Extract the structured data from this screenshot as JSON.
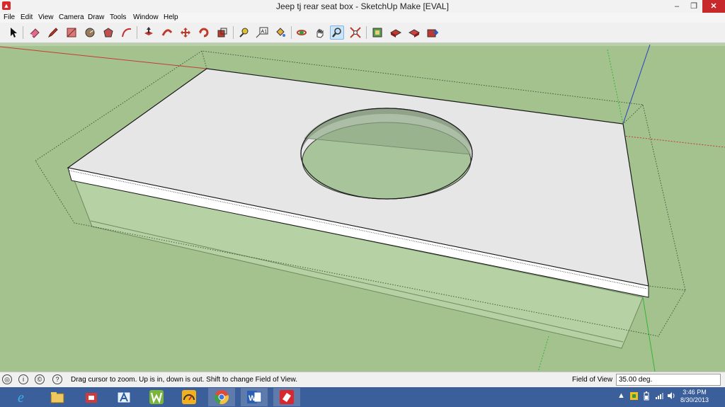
{
  "window": {
    "title": "Jeep tj rear seat box - SketchUp Make [EVAL]",
    "minimize": "–",
    "maximize": "❐",
    "close": "✕"
  },
  "menu": [
    "File",
    "Edit",
    "View",
    "Camera",
    "Draw",
    "Tools",
    "Window",
    "Help"
  ],
  "toolbar": {
    "tools": [
      "select-tool",
      "eraser-tool",
      "pencil-tool",
      "rectangle-tool",
      "circle-tool",
      "polygon-tool",
      "arc-tool",
      "push-pull-tool",
      "follow-me-tool",
      "move-tool",
      "rotate-tool",
      "scale-tool",
      "tape-measure-tool",
      "text-tool",
      "paint-bucket-tool",
      "orbit-tool",
      "pan-tool",
      "zoom-tool",
      "zoom-extents-tool",
      "get-models-tool",
      "share-model-tool",
      "share-component-tool",
      "extension-warehouse-tool"
    ],
    "active_tool": "zoom-tool",
    "text_tool_glyph": "A1"
  },
  "status": {
    "hint": "Drag cursor to zoom.  Up is in, down is out. Shift to change Field of View.",
    "vcb_label": "Field of View",
    "vcb_value": "35.00 deg."
  },
  "taskbar": {
    "apps": [
      "internet-explorer",
      "file-explorer",
      "app-store",
      "app-a",
      "app-w",
      "app-speedometer",
      "chrome",
      "word",
      "sketchup"
    ],
    "word_glyph": "W",
    "clock_time": "3:46 PM",
    "clock_date": "8/30/2013"
  },
  "colors": {
    "viewport_bg": "#a3c28e",
    "red_axis": "#c83a3a",
    "green_axis": "#35b535",
    "blue_axis": "#2a40c0",
    "top_face": "#e6e6e6",
    "taskbar": "#3b5f9a"
  }
}
